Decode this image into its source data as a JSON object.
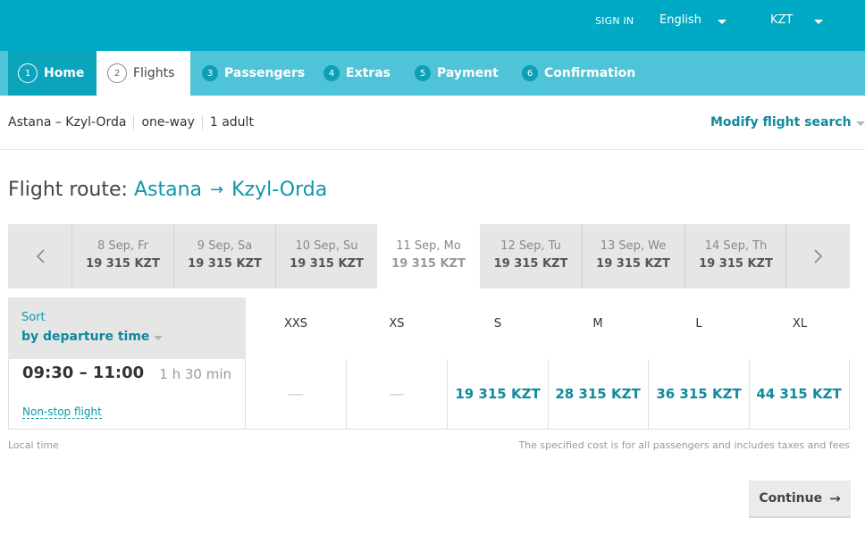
{
  "topbar": {
    "sign_in": "SIGN IN",
    "language": "English",
    "currency": "KZT"
  },
  "steps": [
    {
      "num": "1",
      "label": "Home"
    },
    {
      "num": "2",
      "label": "Flights"
    },
    {
      "num": "3",
      "label": "Passengers"
    },
    {
      "num": "4",
      "label": "Extras"
    },
    {
      "num": "5",
      "label": "Payment"
    },
    {
      "num": "6",
      "label": "Confirmation"
    }
  ],
  "summary": {
    "route": "Astana – Kzyl-Orda",
    "trip_type": "one-way",
    "passengers": "1 adult",
    "modify": "Modify flight search"
  },
  "heading": {
    "prefix": "Flight route:",
    "from": "Astana",
    "arrow": "→",
    "to": "Kzyl-Orda"
  },
  "dates": [
    {
      "date": "8 Sep, Fr",
      "price": "19 315 KZT"
    },
    {
      "date": "9 Sep, Sa",
      "price": "19 315 KZT"
    },
    {
      "date": "10 Sep, Su",
      "price": "19 315 KZT"
    },
    {
      "date": "11 Sep, Mo",
      "price": "19 315 KZT"
    },
    {
      "date": "12 Sep, Tu",
      "price": "19 315 KZT"
    },
    {
      "date": "13 Sep, We",
      "price": "19 315 KZT"
    },
    {
      "date": "14 Sep, Th",
      "price": "19 315 KZT"
    }
  ],
  "sort": {
    "label": "Sort",
    "value": "by departure time"
  },
  "classes": [
    "XXS",
    "XS",
    "S",
    "M",
    "L",
    "XL"
  ],
  "flight": {
    "time": "09:30 – 11:00",
    "duration": "1 h 30 min",
    "type": "Non-stop flight",
    "fares": [
      "—",
      "—",
      "19 315 KZT",
      "28 315 KZT",
      "36 315 KZT",
      "44 315 KZT"
    ]
  },
  "notes": {
    "local_time": "Local time",
    "cost_note": "The specified cost is for all passengers and includes taxes and fees"
  },
  "continue_label": "Continue",
  "continue_arrow": "→",
  "icons": {
    "prev": "chevron-left-icon",
    "next": "chevron-right-icon"
  },
  "colors": {
    "topbar": "#00a9c4",
    "steps": "#4fc3d7",
    "accent": "#0f8a9e"
  }
}
